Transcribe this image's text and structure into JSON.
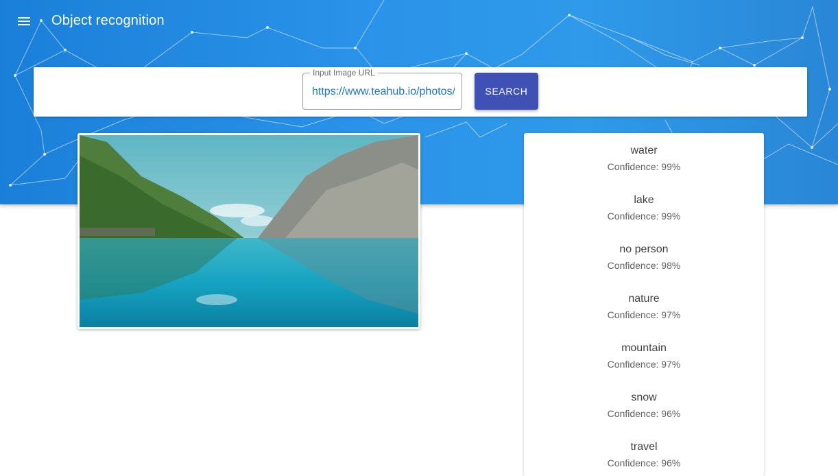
{
  "app": {
    "title": "Object recognition",
    "menu_icon": "menu-icon",
    "hero_color": "#2b93e9"
  },
  "search": {
    "label": "Input Image URL",
    "value": "https://www.teahub.io/photos/full/",
    "button_label": "SEARCH",
    "button_color": "#3f51b5"
  },
  "image": {
    "description_icon": "lake-mountain-photo"
  },
  "results": [
    {
      "label": "water",
      "confidence": "Confidence: 99%"
    },
    {
      "label": "lake",
      "confidence": "Confidence: 99%"
    },
    {
      "label": "no person",
      "confidence": "Confidence: 98%"
    },
    {
      "label": "nature",
      "confidence": "Confidence: 97%"
    },
    {
      "label": "mountain",
      "confidence": "Confidence: 97%"
    },
    {
      "label": "snow",
      "confidence": "Confidence: 96%"
    },
    {
      "label": "travel",
      "confidence": "Confidence: 96%"
    }
  ]
}
